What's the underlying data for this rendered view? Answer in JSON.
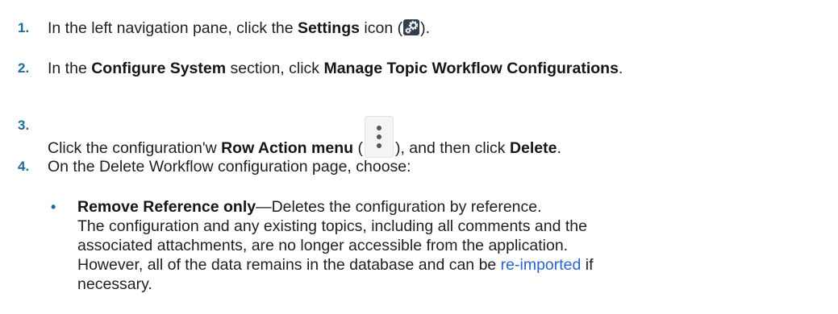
{
  "steps": [
    {
      "number": "1.",
      "pre": "In the left navigation pane, click the ",
      "bold": "Settings",
      "mid": " icon (",
      "icon": "settings-gear-icon",
      "post": ")."
    },
    {
      "number": "2.",
      "pre": "In the ",
      "bold": "Configure System",
      "mid": " section, click ",
      "bold2": "Manage Topic Workflow Configurations",
      "post": "."
    },
    {
      "number": "3.",
      "pre": "Click the configuration'w ",
      "bold": "Row Action menu",
      "mid": " (",
      "icon": "kebab-menu-icon",
      "mid2": "), and then click ",
      "bold2": "Delete",
      "post": "."
    },
    {
      "number": "4.",
      "text": "On the Delete Workflow configuration page, choose:"
    }
  ],
  "bullet": {
    "symbol": "•",
    "bold": "Remove Reference only",
    "line1_rest": "—Deletes the configuration by reference.",
    "line2": "The configuration and any existing topics, including all comments and the",
    "line3": "associated attachments, are no longer accessible from the application.",
    "line4_pre": "However, all of the data remains in the database and can be ",
    "line4_link": "re-imported",
    "line4_post": " if",
    "line5": "necessary."
  },
  "colors": {
    "step_number": "#1c6d9e",
    "link": "#2b65ce",
    "text": "#1f1f1f"
  }
}
